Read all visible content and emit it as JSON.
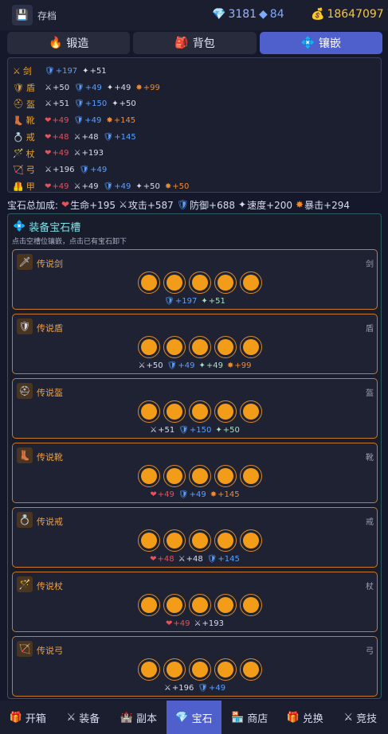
{
  "header": {
    "save_label": "存档",
    "gems": "3181",
    "blue": "84",
    "gold": "18647097"
  },
  "tabs": [
    {
      "label": "锻造",
      "icon": "🔥"
    },
    {
      "label": "背包",
      "icon": "🎒"
    },
    {
      "label": "镶嵌",
      "icon": "💠"
    }
  ],
  "stats": [
    {
      "slot": "剑",
      "icon": "⚔",
      "vals": [
        [
          "🛡",
          "+197",
          "c-blue"
        ],
        [
          "✦",
          "+51",
          "c-white"
        ]
      ]
    },
    {
      "slot": "盾",
      "icon": "🛡",
      "vals": [
        [
          "⚔",
          "+50",
          "c-white"
        ],
        [
          "🛡",
          "+49",
          "c-blue"
        ],
        [
          "✦",
          "+49",
          "c-white"
        ],
        [
          "✸",
          "+99",
          "c-orange"
        ]
      ]
    },
    {
      "slot": "盔",
      "icon": "⛑",
      "vals": [
        [
          "⚔",
          "+51",
          "c-white"
        ],
        [
          "🛡",
          "+150",
          "c-blue"
        ],
        [
          "✦",
          "+50",
          "c-white"
        ]
      ]
    },
    {
      "slot": "靴",
      "icon": "👢",
      "vals": [
        [
          "❤",
          "+49",
          "c-red"
        ],
        [
          "🛡",
          "+49",
          "c-blue"
        ],
        [
          "✸",
          "+145",
          "c-orange"
        ]
      ]
    },
    {
      "slot": "戒",
      "icon": "💍",
      "vals": [
        [
          "❤",
          "+48",
          "c-red"
        ],
        [
          "⚔",
          "+48",
          "c-white"
        ],
        [
          "🛡",
          "+145",
          "c-blue"
        ]
      ]
    },
    {
      "slot": "杖",
      "icon": "🪄",
      "vals": [
        [
          "❤",
          "+49",
          "c-red"
        ],
        [
          "⚔",
          "+193",
          "c-white"
        ]
      ]
    },
    {
      "slot": "弓",
      "icon": "🏹",
      "vals": [
        [
          "⚔",
          "+196",
          "c-white"
        ],
        [
          "🛡",
          "+49",
          "c-blue"
        ]
      ]
    },
    {
      "slot": "甲",
      "icon": "🦺",
      "vals": [
        [
          "❤",
          "+49",
          "c-red"
        ],
        [
          "⚔",
          "+49",
          "c-white"
        ],
        [
          "🛡",
          "+49",
          "c-blue"
        ],
        [
          "✦",
          "+50",
          "c-white"
        ],
        [
          "✸",
          "+50",
          "c-orange"
        ]
      ]
    }
  ],
  "totals": {
    "prefix": "宝石总加成:",
    "items": [
      [
        "❤",
        "生命+195",
        "c-red"
      ],
      [
        "⚔",
        "攻击+587",
        "c-white"
      ],
      [
        "🛡",
        "防御+688",
        "c-blue"
      ],
      [
        "✦",
        "速度+200",
        "c-white"
      ],
      [
        "✸",
        "暴击+294",
        "c-orange"
      ]
    ]
  },
  "section": {
    "title": "装备宝石槽",
    "hint": "点击空槽位镶嵌，点击已有宝石卸下"
  },
  "cards": [
    {
      "name": "传说剑",
      "slot": "剑",
      "icon": "🗡",
      "bonus": [
        [
          "🛡",
          "+197",
          "c-blue"
        ],
        [
          "✦",
          "+51",
          "c-green"
        ]
      ]
    },
    {
      "name": "传说盾",
      "slot": "盾",
      "icon": "🛡",
      "bonus": [
        [
          "⚔",
          "+50",
          "c-white"
        ],
        [
          "🛡",
          "+49",
          "c-blue"
        ],
        [
          "✦",
          "+49",
          "c-green"
        ],
        [
          "✸",
          "+99",
          "c-orange"
        ]
      ]
    },
    {
      "name": "传说盔",
      "slot": "盔",
      "icon": "⛑",
      "bonus": [
        [
          "⚔",
          "+51",
          "c-white"
        ],
        [
          "🛡",
          "+150",
          "c-blue"
        ],
        [
          "✦",
          "+50",
          "c-green"
        ]
      ]
    },
    {
      "name": "传说靴",
      "slot": "靴",
      "icon": "👢",
      "bonus": [
        [
          "❤",
          "+49",
          "c-red"
        ],
        [
          "🛡",
          "+49",
          "c-blue"
        ],
        [
          "✸",
          "+145",
          "c-orange"
        ]
      ]
    },
    {
      "name": "传说戒",
      "slot": "戒",
      "icon": "💍",
      "bonus": [
        [
          "❤",
          "+48",
          "c-red"
        ],
        [
          "⚔",
          "+48",
          "c-white"
        ],
        [
          "🛡",
          "+145",
          "c-blue"
        ]
      ]
    },
    {
      "name": "传说杖",
      "slot": "杖",
      "icon": "🪄",
      "bonus": [
        [
          "❤",
          "+49",
          "c-red"
        ],
        [
          "⚔",
          "+193",
          "c-white"
        ]
      ]
    },
    {
      "name": "传说弓",
      "slot": "弓",
      "icon": "🏹",
      "bonus": [
        [
          "⚔",
          "+196",
          "c-white"
        ],
        [
          "🛡",
          "+49",
          "c-blue"
        ]
      ]
    }
  ],
  "nav": [
    {
      "label": "开箱",
      "icon": "🎁"
    },
    {
      "label": "装备",
      "icon": "⚔"
    },
    {
      "label": "副本",
      "icon": "🏰"
    },
    {
      "label": "宝石",
      "icon": "💎"
    },
    {
      "label": "商店",
      "icon": "🏪"
    },
    {
      "label": "兑换",
      "icon": "🎁"
    },
    {
      "label": "竞技",
      "icon": "⚔"
    }
  ],
  "colors": {
    "accent": "#4f5fcc",
    "gold": "#f1c64c",
    "gem": "#f39c1a"
  }
}
